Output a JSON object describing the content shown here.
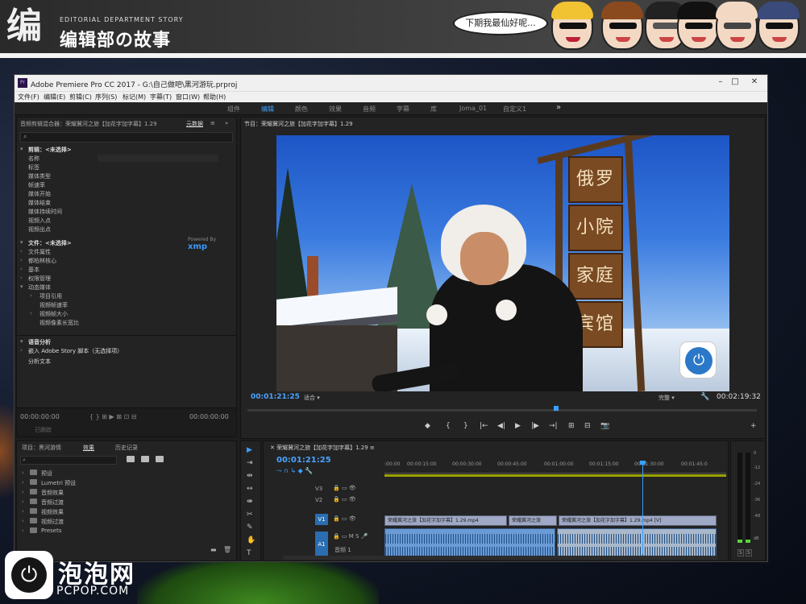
{
  "banner": {
    "logo_glyph": "编",
    "logo_sub": "EDITORIAL DEPARTMENT STORY",
    "logo_main": "编辑部の故事",
    "bubble_text": "下期我最仙好呢..."
  },
  "app": {
    "title": "Adobe Premiere Pro CC 2017 - G:\\自己做吧\\黑河游玩.prproj",
    "icon_label": "Pr",
    "menu": [
      "文件(F)",
      "编辑(E)",
      "剪辑(C)",
      "序列(S)",
      "标记(M)",
      "字幕(T)",
      "窗口(W)",
      "帮助(H)"
    ]
  },
  "workspaces": {
    "items": [
      "组件",
      "编辑",
      "颜色",
      "效果",
      "音频",
      "字幕",
      "库",
      "Joma_01",
      "自定义1"
    ],
    "active": "编辑",
    "more": "»"
  },
  "metadata_panel": {
    "tab_source": "音频剪辑混合器：荣耀冀河之旅【加花字加字幕】1.29",
    "tab_active": "元数据",
    "clip_header": "剪辑：<未选择>",
    "clip_fields": [
      "名称",
      "标签",
      "媒体类型",
      "帧速率",
      "媒体开始",
      "媒体结束",
      "媒体持续时间",
      "视频入点",
      "视频出点"
    ],
    "file_header": "文件：<未选择>",
    "powered_by": "Powered By",
    "xmp": "xmp",
    "file_sections": [
      "文件属性",
      "都柏林核心",
      "基本",
      "权限管理",
      "动态媒体"
    ],
    "dynamic_media_items": [
      "项目引用",
      "视频帧速率",
      "视频帧大小",
      "视频像素长宽比"
    ],
    "speech_title": "语音分析",
    "speech_embed": "嵌入 Adobe Story 脚本（无选择项）",
    "analyze_text": "分析文本",
    "tc_left": "00:00:00:00",
    "tc_right": "00:00:00:00",
    "tracked": "已跟踪"
  },
  "program": {
    "tab": "节目：荣耀冀河之旅【加花字加字幕】1.29",
    "signs": [
      "俄罗斯",
      "小院",
      "家庭",
      "宾馆"
    ],
    "timecode_current": "00:01:21:25",
    "fit": "适合",
    "quality": "完整",
    "timecode_duration": "00:02:19:32",
    "transport": [
      "◆",
      "{",
      "}",
      "|←",
      "◀|",
      "▶",
      "|▶",
      "→|",
      "⊞",
      "⊟",
      "📷",
      "+"
    ]
  },
  "project_panel": {
    "tabs": [
      "项目：黑河游情",
      "效果",
      "历史记录"
    ],
    "active_tab": "效果",
    "bins": [
      "预设",
      "Lumetri 预设",
      "音频效果",
      "音频过渡",
      "视频效果",
      "视频过渡",
      "Presets"
    ]
  },
  "timeline": {
    "tab": "荣耀冀河之旅【加花字加字幕】1.29",
    "timecode": "00:01:21:25",
    "ruler": [
      ":00:00",
      "00:00:15:00",
      "00:00:30:00",
      "00:00:45:00",
      "00:01:00:00",
      "00:01:15:00",
      "00:01:30:00",
      "00:01:45:0"
    ],
    "tracks": [
      "V3",
      "V2",
      "V1",
      "A1"
    ],
    "audio_label": "音频 1",
    "v1_clips": [
      "荣耀冀河之旅【加花字加字幕】1.29.mp4",
      "荣耀冀河之旅",
      "荣耀冀河之旅【加花字加字幕】1.29.mp4 [V]"
    ]
  },
  "meter": {
    "labels": [
      "0",
      "-12",
      "-24",
      "-36",
      "-48",
      "dB"
    ],
    "solo": [
      "S",
      "S"
    ]
  },
  "watermark": {
    "cn": "泡泡网",
    "en": "PCPOP.COM"
  },
  "colors": {
    "accent": "#3aa0ff",
    "titlebar": "#f0f0f0",
    "panel": "#232323"
  }
}
